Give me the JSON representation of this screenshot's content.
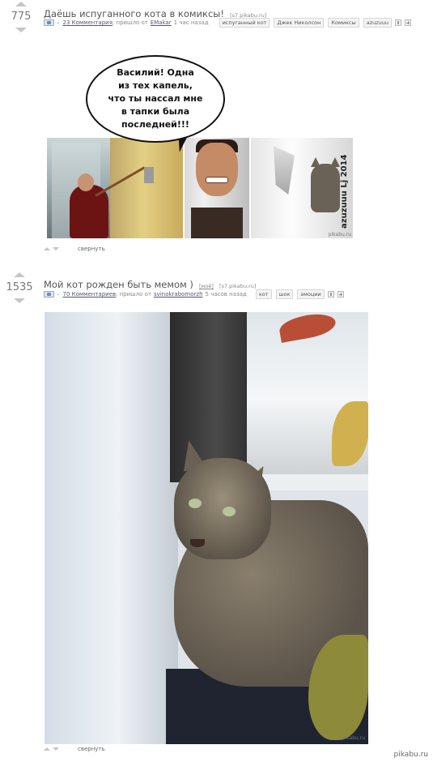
{
  "posts": [
    {
      "score": "775",
      "title": "Даёшь испуганного кота в комиксы!",
      "source": "[s7.pikabu.ru]",
      "comments_link": "23 Комментария",
      "meta_pre": "; пришло от",
      "author": "EMakar",
      "time": "1 час назад",
      "tags": [
        "испуганный кот",
        "Джек Николсон",
        "Комиксы",
        "azuzuuu"
      ],
      "collapse_label": "свернуть",
      "image": {
        "bubble_text": "Василий! Одна\nиз  тех капель,\nчто  ты нассал мне\nв тапки была\nпоследней!!!",
        "vertical_watermark": "azuzuuu Lj 2014",
        "site_mark": "pikabu.ru"
      }
    },
    {
      "score": "1535",
      "title": "Мой кот рожден быть мемом )",
      "nsfw": "[моё]",
      "source": "[s7.pikabu.ru]",
      "comments_link": "70 Комментариев",
      "meta_pre": "; пришло от",
      "author": "svinokrabomorzh",
      "time": "5 часов назад",
      "tags": [
        "кот",
        "шок",
        "эмоции"
      ],
      "collapse_label": "свернуть",
      "image": {
        "site_mark": "pikabu.ru"
      }
    }
  ],
  "corner_watermark": "pikabu.ru",
  "icons": {
    "vote_up": "arrow-up",
    "vote_down": "arrow-down",
    "comments": "comment-bubble",
    "delete": "trash",
    "save": "plus"
  }
}
